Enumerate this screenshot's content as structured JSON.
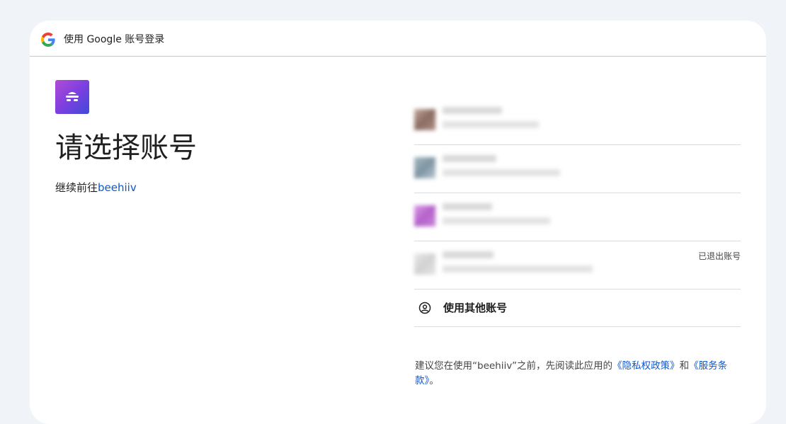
{
  "header": {
    "title": "使用 Google 账号登录"
  },
  "main": {
    "title": "请选择账号",
    "subtitle_prefix": "继续前往",
    "app_name": "beehiiv"
  },
  "accounts": [
    {
      "status": ""
    },
    {
      "status": ""
    },
    {
      "status": ""
    },
    {
      "status": "已退出账号"
    }
  ],
  "other_account": {
    "label": "使用其他账号"
  },
  "disclaimer": {
    "prefix": "建议您在使用“beehiiv”之前，先阅读此应用的",
    "privacy_link": "《隐私权政策》",
    "conjunction": "和",
    "terms_link": "《服务条款》",
    "suffix": "。"
  },
  "colors": {
    "link": "#0b57d0",
    "background": "#f0f4f9",
    "card": "#ffffff"
  }
}
